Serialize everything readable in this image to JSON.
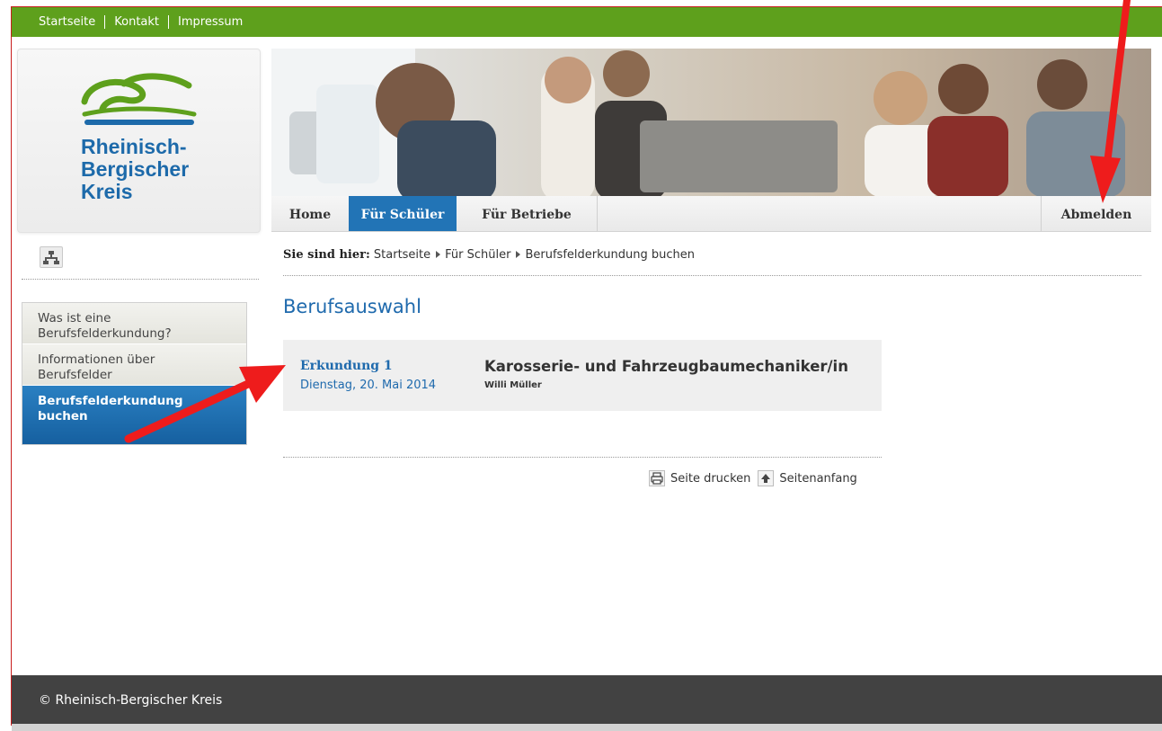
{
  "topbar": {
    "links": [
      "Startseite",
      "Kontakt",
      "Impressum"
    ]
  },
  "logo": {
    "lines": [
      "Rheinisch-",
      "Bergischer",
      "Kreis"
    ]
  },
  "nav": {
    "home": "Home",
    "schueler": "Für Schüler",
    "betriebe": "Für Betriebe",
    "abmelden": "Abmelden"
  },
  "breadcrumb": {
    "lead": "Sie sind hier:",
    "items": [
      "Startseite",
      "Für Schüler",
      "Berufsfelderkundung buchen"
    ]
  },
  "sidenav": {
    "items": [
      {
        "line1": "Was ist eine",
        "line2": "Berufsfelderkundung?"
      },
      {
        "line1": "Informationen über",
        "line2": "Berufsfelder"
      },
      {
        "line1": "Berufsfelderkundung",
        "line2": "buchen"
      }
    ]
  },
  "main": {
    "heading": "Berufsauswahl",
    "booking": {
      "label": "Erkundung 1",
      "date": "Dienstag, 20. Mai 2014",
      "title": "Karosserie- und Fahrzeugbaumechaniker/in",
      "person": "Willi Müller"
    }
  },
  "tools": {
    "print": "Seite drucken",
    "top": "Seitenanfang"
  },
  "footer": {
    "copyright": "© Rheinisch-Bergischer Kreis"
  },
  "colors": {
    "green": "#5ea01c",
    "blue": "#1f6aad",
    "nav_active": "#2274b6",
    "annotation": "#ee1c1c"
  },
  "icons": [
    "sitemap-icon",
    "print-icon",
    "arrow-up-icon",
    "annotation-arrow"
  ]
}
